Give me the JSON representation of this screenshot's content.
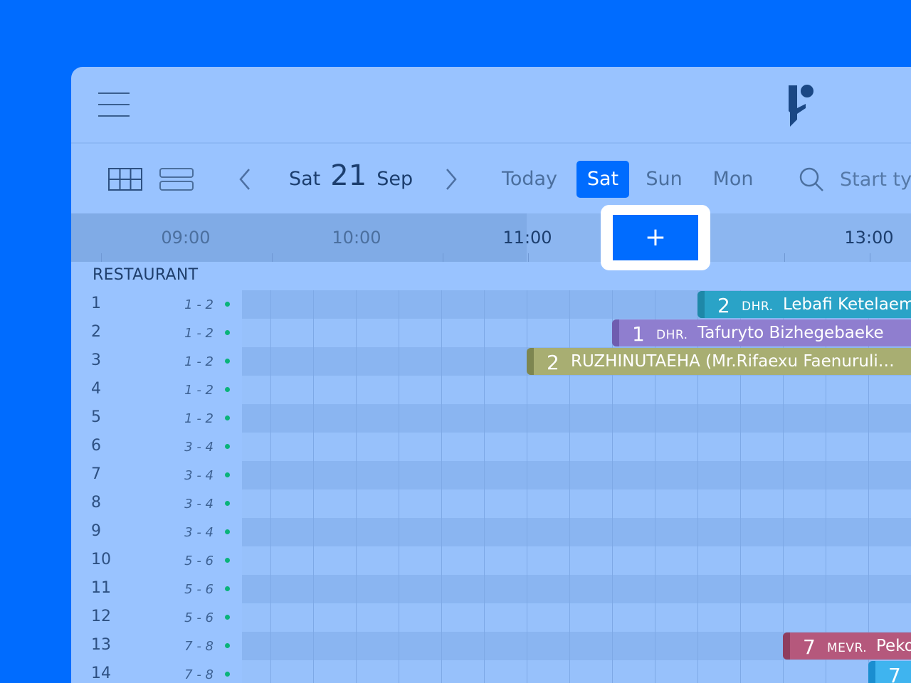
{
  "toolbar": {
    "date": {
      "dow": "Sat",
      "day": "21",
      "month": "Sep"
    },
    "today_label": "Today",
    "days": [
      "Sat",
      "Sun",
      "Mon"
    ],
    "search_placeholder": "Start ty"
  },
  "timeline": {
    "hours": [
      "09:00",
      "10:00",
      "11:00",
      "13:00"
    ],
    "add_label": "+"
  },
  "section": {
    "name": "RESTAURANT"
  },
  "tables": [
    {
      "number": "1",
      "capacity": "1 - 2"
    },
    {
      "number": "2",
      "capacity": "1 - 2"
    },
    {
      "number": "3",
      "capacity": "1 - 2"
    },
    {
      "number": "4",
      "capacity": "1 - 2"
    },
    {
      "number": "5",
      "capacity": "1 - 2"
    },
    {
      "number": "6",
      "capacity": "3 - 4"
    },
    {
      "number": "7",
      "capacity": "3 - 4"
    },
    {
      "number": "8",
      "capacity": "3 - 4"
    },
    {
      "number": "9",
      "capacity": "3 - 4"
    },
    {
      "number": "10",
      "capacity": "5 - 6"
    },
    {
      "number": "11",
      "capacity": "5 - 6"
    },
    {
      "number": "12",
      "capacity": "5 - 6"
    },
    {
      "number": "13",
      "capacity": "7 - 8"
    },
    {
      "number": "14",
      "capacity": "7 - 8"
    }
  ],
  "reservations": [
    {
      "table": "1",
      "guests": "2",
      "title": "DHR.",
      "name": "Lebafi Ketelaem",
      "color": "#2aa3c7",
      "edge": "#1e88a8"
    },
    {
      "table": "2",
      "guests": "1",
      "title": "DHR.",
      "name": "Tafuryto Bizhegebaeke",
      "color": "#8f7ecf",
      "edge": "#6f5daf"
    },
    {
      "table": "3",
      "guests": "2",
      "title": "",
      "name": "RUZHINUTAEHA (Mr.Rifaexu Faenuruli…",
      "color": "#a8ae72",
      "edge": "#7d8650"
    },
    {
      "table": "13",
      "guests": "7",
      "title": "MEVR.",
      "name": "Peko",
      "color": "#b5587c",
      "edge": "#8f3d5e"
    },
    {
      "table": "14",
      "guests": "7",
      "title": "",
      "name": "",
      "color": "#3fb4ef",
      "edge": "#1a8ed0"
    }
  ]
}
